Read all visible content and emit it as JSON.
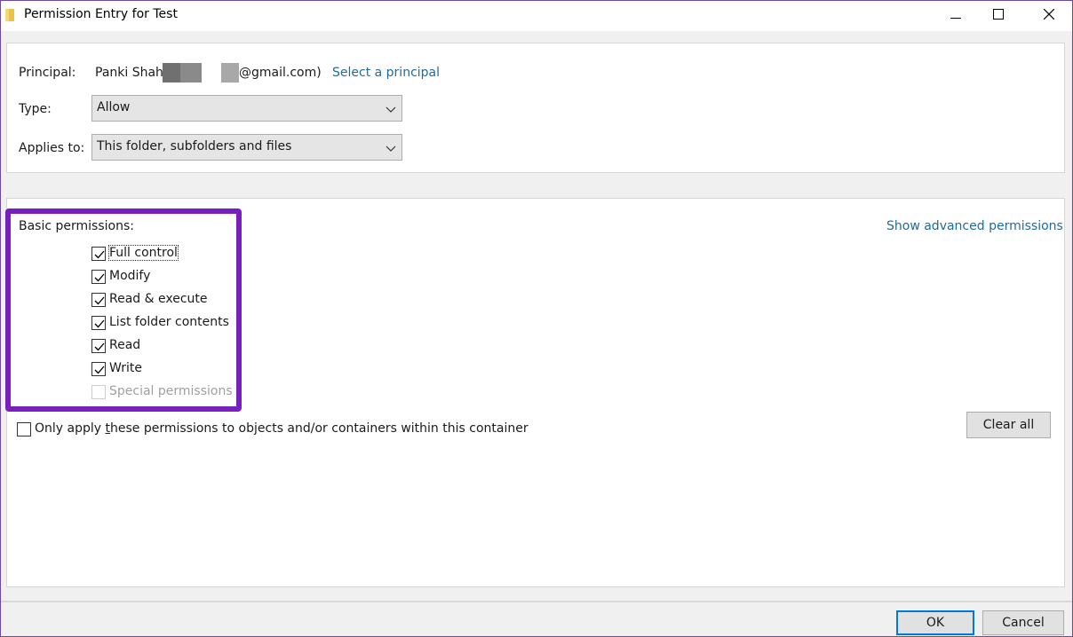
{
  "window": {
    "title": "Permission Entry for Test",
    "folder_icon": "folder-icon",
    "controls": [
      "minimize-icon",
      "maximize-icon",
      "close-icon"
    ]
  },
  "principal": {
    "label": "Principal:",
    "name": "Panki Shah",
    "email_suffix": "@gmail.com)",
    "select_link": "Select a principal"
  },
  "type": {
    "label": "Type:",
    "value": "Allow"
  },
  "applies_to": {
    "label": "Applies to:",
    "value": "This folder, subfolders and files"
  },
  "permissions": {
    "heading": "Basic permissions:",
    "advanced_link": "Show advanced permissions",
    "items": [
      {
        "label": "Full control",
        "checked": true,
        "enabled": true
      },
      {
        "label": "Modify",
        "checked": true,
        "enabled": true
      },
      {
        "label": "Read & execute",
        "checked": true,
        "enabled": true
      },
      {
        "label": "List folder contents",
        "checked": true,
        "enabled": true
      },
      {
        "label": "Read",
        "checked": true,
        "enabled": true
      },
      {
        "label": "Write",
        "checked": true,
        "enabled": true
      },
      {
        "label": "Special permissions",
        "checked": false,
        "enabled": false
      }
    ],
    "only_apply": {
      "label_pre": "Only apply ",
      "label_accel": "t",
      "label_post": "hese permissions to objects and/or containers within this container",
      "checked": false
    },
    "clear_all": "Clear all"
  },
  "footer": {
    "ok": "OK",
    "cancel": "Cancel"
  },
  "colors": {
    "highlight": "#7a1fbf",
    "link": "#1f6b9b",
    "default_button_border": "#0078d7"
  }
}
